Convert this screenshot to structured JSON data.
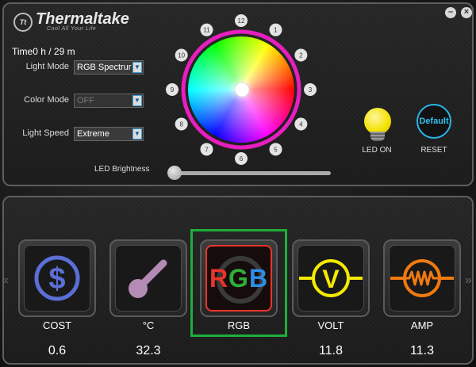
{
  "brand": {
    "name": "Thermaltake",
    "tagline": "Cool All Your Life",
    "mark": "Tt"
  },
  "window": {
    "minimize_glyph": "–",
    "close_glyph": "×"
  },
  "timer": {
    "label": "Time",
    "value": "0 h / 29 m"
  },
  "controls": {
    "light_mode": {
      "label": "Light Mode",
      "value": "RGB Spectrur"
    },
    "color_mode": {
      "label": "Color Mode",
      "value": "OFF"
    },
    "light_speed": {
      "label": "Light Speed",
      "value": "Extreme"
    },
    "brightness": {
      "label": "LED Brightness",
      "level": 0.0
    }
  },
  "wheel": {
    "positions": [
      "12",
      "1",
      "2",
      "3",
      "4",
      "5",
      "6",
      "7",
      "8",
      "9",
      "10",
      "11"
    ],
    "ring_color": "#e81ec0"
  },
  "led": {
    "label": "LED ON",
    "color": "#f2e200"
  },
  "reset": {
    "button_label": "Default",
    "label": "RESET",
    "color": "#2bb5e8"
  },
  "nav": {
    "left": "«",
    "right": "»"
  },
  "cards": [
    {
      "label": "COST",
      "value": "0.6",
      "icon": "dollar-icon",
      "color": "#5b6fd6"
    },
    {
      "label": "°C",
      "value": "32.3",
      "icon": "thermometer-icon",
      "color": "#b48bb4"
    },
    {
      "label": "RGB",
      "value": "",
      "icon": "rgb-icon",
      "letters": [
        "R",
        "G",
        "B"
      ],
      "letter_colors": [
        "#e8352a",
        "#2fae3a",
        "#2d8ee6"
      ]
    },
    {
      "label": "VOLT",
      "value": "11.8",
      "icon": "volt-icon",
      "color": "#f4ea00",
      "glyph": "V"
    },
    {
      "label": "AMP",
      "value": "11.3",
      "icon": "amp-icon",
      "color": "#f07a10"
    }
  ]
}
